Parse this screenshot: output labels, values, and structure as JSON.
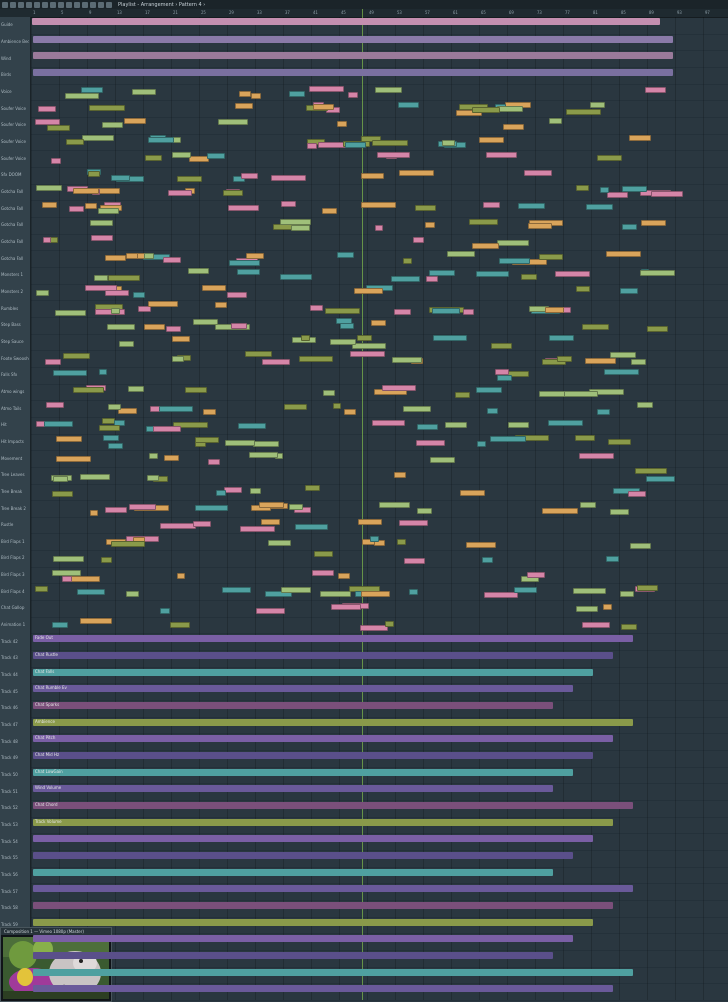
{
  "window": {
    "title": "Playlist - Arrangement › Pattern 4 ›"
  },
  "toolbar": {
    "icons": [
      "menu-icon",
      "play-icon",
      "stop-icon",
      "record-icon",
      "snap-icon",
      "pencil-icon",
      "paint-icon",
      "delete-icon",
      "mute-icon",
      "slip-icon",
      "slice-icon",
      "select-icon",
      "zoom-icon",
      "playback-icon"
    ]
  },
  "ruler": {
    "bars": [
      "1",
      "5",
      "9",
      "13",
      "17",
      "21",
      "25",
      "29",
      "33",
      "37",
      "41",
      "45",
      "49",
      "53",
      "57",
      "61",
      "65",
      "69",
      "73",
      "77",
      "81",
      "85",
      "89",
      "93",
      "97"
    ]
  },
  "tracks": [
    {
      "name": "Guide"
    },
    {
      "name": "Ambience Bed"
    },
    {
      "name": "Wind"
    },
    {
      "name": "Birds"
    },
    {
      "name": "Voice"
    },
    {
      "name": "Soufer Voice"
    },
    {
      "name": "Soufer Voice"
    },
    {
      "name": "Soufer Voice"
    },
    {
      "name": "Soufer Voice"
    },
    {
      "name": "Sfx DOOM"
    },
    {
      "name": "Gotcha Fall"
    },
    {
      "name": "Gotcha Fall"
    },
    {
      "name": "Gotcha Fall"
    },
    {
      "name": "Gotcha Fall"
    },
    {
      "name": "Gotcha Fall"
    },
    {
      "name": "Monsters 1"
    },
    {
      "name": "Monsters 2"
    },
    {
      "name": "Rumbles"
    },
    {
      "name": "Step Bass"
    },
    {
      "name": "Step Sauce"
    },
    {
      "name": "Foote Swooshes"
    },
    {
      "name": "Falls Sfx"
    },
    {
      "name": "Atmo wings"
    },
    {
      "name": "Atmo Tails"
    },
    {
      "name": "Hit"
    },
    {
      "name": "Hit Impacts"
    },
    {
      "name": "Movement"
    },
    {
      "name": "Tree Leaves"
    },
    {
      "name": "Tree Break"
    },
    {
      "name": "Tree Break 2"
    },
    {
      "name": "Rustle"
    },
    {
      "name": "Bird Flaps 1"
    },
    {
      "name": "Bird Flaps 2"
    },
    {
      "name": "Bird Flaps 3"
    },
    {
      "name": "Bird Flaps 4"
    },
    {
      "name": "Chat Gallop"
    },
    {
      "name": "Animation 1"
    },
    {
      "name": "Track 42"
    },
    {
      "name": "Track 43"
    },
    {
      "name": "Track 44"
    },
    {
      "name": "Track 45"
    },
    {
      "name": "Track 46"
    },
    {
      "name": "Track 47"
    },
    {
      "name": "Track 48"
    },
    {
      "name": "Track 49"
    },
    {
      "name": "Track 50"
    },
    {
      "name": "Track 51"
    },
    {
      "name": "Track 52"
    },
    {
      "name": "Track 53"
    },
    {
      "name": "Track 54"
    },
    {
      "name": "Track 55"
    },
    {
      "name": "Track 56"
    },
    {
      "name": "Track 57"
    },
    {
      "name": "Track 58"
    },
    {
      "name": "Track 59"
    },
    {
      "name": "Track 60"
    },
    {
      "name": "Track 61"
    },
    {
      "name": "Track 62"
    },
    {
      "name": "Track 63"
    }
  ],
  "automation_clips": [
    {
      "label": "Fade Out"
    },
    {
      "label": "Chat Rustle"
    },
    {
      "label": "Chat Falls"
    },
    {
      "label": "Chat Rumble Ev"
    },
    {
      "label": "Chat Sparks"
    },
    {
      "label": "Ambience"
    },
    {
      "label": "Chat Pitch"
    },
    {
      "label": "Chat Mid Hz"
    },
    {
      "label": "Chat LowGain"
    },
    {
      "label": "Wind Volume"
    },
    {
      "label": "Chat Chord"
    },
    {
      "label": "Track Volume"
    }
  ],
  "preview": {
    "title": "Composition 1 — Vimeo 1080p (Master)"
  },
  "colors": {
    "background": "#2a3740",
    "header_bg": "#33424b",
    "clip_green": "#9fbf7a",
    "clip_orange": "#d9a45b",
    "clip_pink": "#d585a8",
    "clip_purple": "#7a5fa5",
    "clip_teal": "#4fa0a0",
    "clip_olive": "#8a9a4a",
    "playhead": "#8fd14f"
  }
}
